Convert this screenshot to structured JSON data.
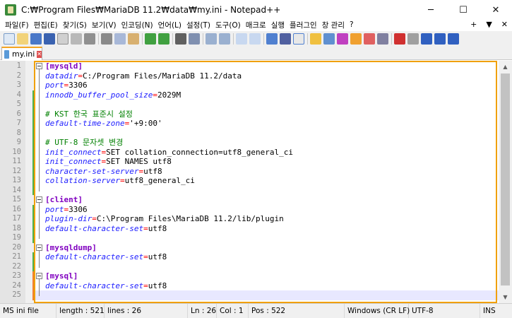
{
  "window": {
    "title": "C:₩Program Files₩MariaDB 11.2₩data₩my.ini - Notepad++",
    "minimize": "─",
    "maximize": "☐",
    "close": "✕"
  },
  "menu": {
    "items": [
      "파일(F)",
      "편집(E)",
      "찾기(S)",
      "보기(V)",
      "인코딩(N)",
      "언어(L)",
      "설정(T)",
      "도구(O)",
      "매크로",
      "실행",
      "플러그인",
      "창 관리",
      "?"
    ],
    "right": [
      "+",
      "▼",
      "✕"
    ]
  },
  "tab": {
    "label": "my.ini",
    "close": "✕"
  },
  "editor": {
    "lines": [
      {
        "n": "1",
        "section": "[mysqld]"
      },
      {
        "n": "2",
        "key": "datadir",
        "val": "C:/Program Files/MariaDB 11.2/data"
      },
      {
        "n": "3",
        "key": "port",
        "val": "3306"
      },
      {
        "n": "4",
        "key": "innodb_buffer_pool_size",
        "val": "2029M"
      },
      {
        "n": "5"
      },
      {
        "n": "6",
        "comment": "# KST 한국 표준시 설정"
      },
      {
        "n": "7",
        "key": "default-time-zone",
        "val": "'+9:00'"
      },
      {
        "n": "8"
      },
      {
        "n": "9",
        "comment": "# UTF-8 문자셋 변경"
      },
      {
        "n": "10",
        "key": "init_connect",
        "val": "SET collation_connection=utf8_general_ci"
      },
      {
        "n": "11",
        "key": "init_connect",
        "val": "SET NAMES utf8"
      },
      {
        "n": "12",
        "key": "character-set-server",
        "val": "utf8"
      },
      {
        "n": "13",
        "key": "collation-server",
        "val": "utf8_general_ci"
      },
      {
        "n": "14"
      },
      {
        "n": "15",
        "section": "[client]"
      },
      {
        "n": "16",
        "key": "port",
        "val": "3306"
      },
      {
        "n": "17",
        "key": "plugin-dir",
        "val": "C:\\Program Files\\MariaDB 11.2/lib/plugin"
      },
      {
        "n": "18",
        "key": "default-character-set",
        "val": "utf8"
      },
      {
        "n": "19"
      },
      {
        "n": "20",
        "section": "[mysqldump]"
      },
      {
        "n": "21",
        "key": "default-character-set",
        "val": "utf8"
      },
      {
        "n": "22"
      },
      {
        "n": "23",
        "section": "[mysql]"
      },
      {
        "n": "24",
        "key": "default-character-set",
        "val": "utf8"
      },
      {
        "n": "25"
      }
    ]
  },
  "status": {
    "lang": "MS ini file",
    "length": "length : 521",
    "lines": "lines : 26",
    "ln": "Ln : 26",
    "col": "Col : 1",
    "pos": "Pos : 522",
    "eol": "Windows (CR LF)",
    "encoding": "UTF-8",
    "mode": "INS"
  },
  "colors": {
    "section": "#8000c0",
    "key": "#2020ff",
    "comment": "#008000",
    "accent": "#f0a000"
  }
}
